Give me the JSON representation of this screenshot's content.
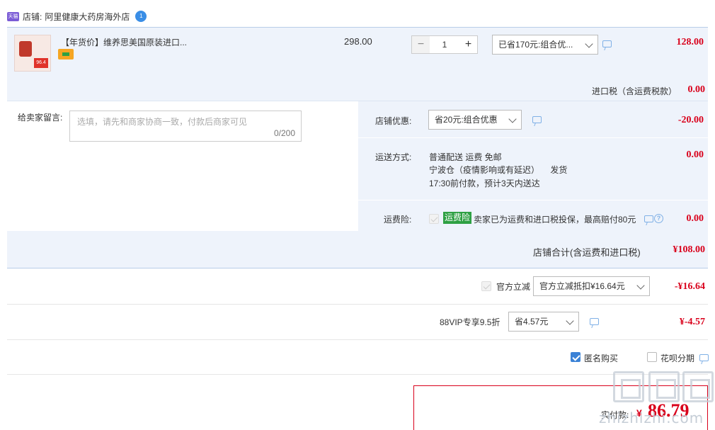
{
  "shop": {
    "label": "店铺:",
    "name": "阿里健康大药房海外店",
    "ww_count": "1",
    "icon_text": "天猫"
  },
  "item": {
    "title": "【年货价】维养思美国原装进口...",
    "unit_price": "298.00",
    "quantity": "1",
    "promo_select": "已省170元:组合优...",
    "amount": "128.00",
    "tax_label": "进口税（含运费税款）",
    "tax_amount": "0.00",
    "thumb_text": "96.4"
  },
  "memo": {
    "label": "给卖家留言:",
    "placeholder": "选填，请先和商家协商一致，付款后商家可见",
    "count": "0/200"
  },
  "shop_discount": {
    "label": "店铺优惠:",
    "select": "省20元:组合优惠",
    "amount": "-20.00"
  },
  "shipping": {
    "label": "运送方式:",
    "line1": "普通配送 运费 免邮",
    "line2": "宁波仓（疫情影响或有延迟）",
    "line2_suffix": "发货",
    "line3": "17:30前付款，预计3天内送达",
    "amount": "0.00"
  },
  "insurance": {
    "label": "运费险:",
    "tag": "运费险",
    "text": "卖家已为运费和进口税投保，最高赔付80元",
    "amount": "0.00"
  },
  "shop_total": {
    "label": "店铺合计(含运费和进口税)",
    "amount": "¥108.00"
  },
  "official": {
    "label": "官方立减",
    "select": "官方立减抵扣¥16.64元",
    "amount": "-¥16.64"
  },
  "vip": {
    "label": "88VIP专享9.5折",
    "select": "省4.57元",
    "amount": "¥-4.57"
  },
  "options": {
    "anonymous": "匿名购买",
    "huabei": "花呗分期"
  },
  "pay": {
    "label": "实付款:",
    "yen": "¥",
    "amount": "86.79"
  },
  "watermark": {
    "text": "zhizhizhi.com"
  },
  "colors": {
    "accent_red": "#d9001b",
    "panel_blue": "#eef3fb",
    "check_blue": "#3b82d6",
    "insurance_green": "#2ea043"
  }
}
